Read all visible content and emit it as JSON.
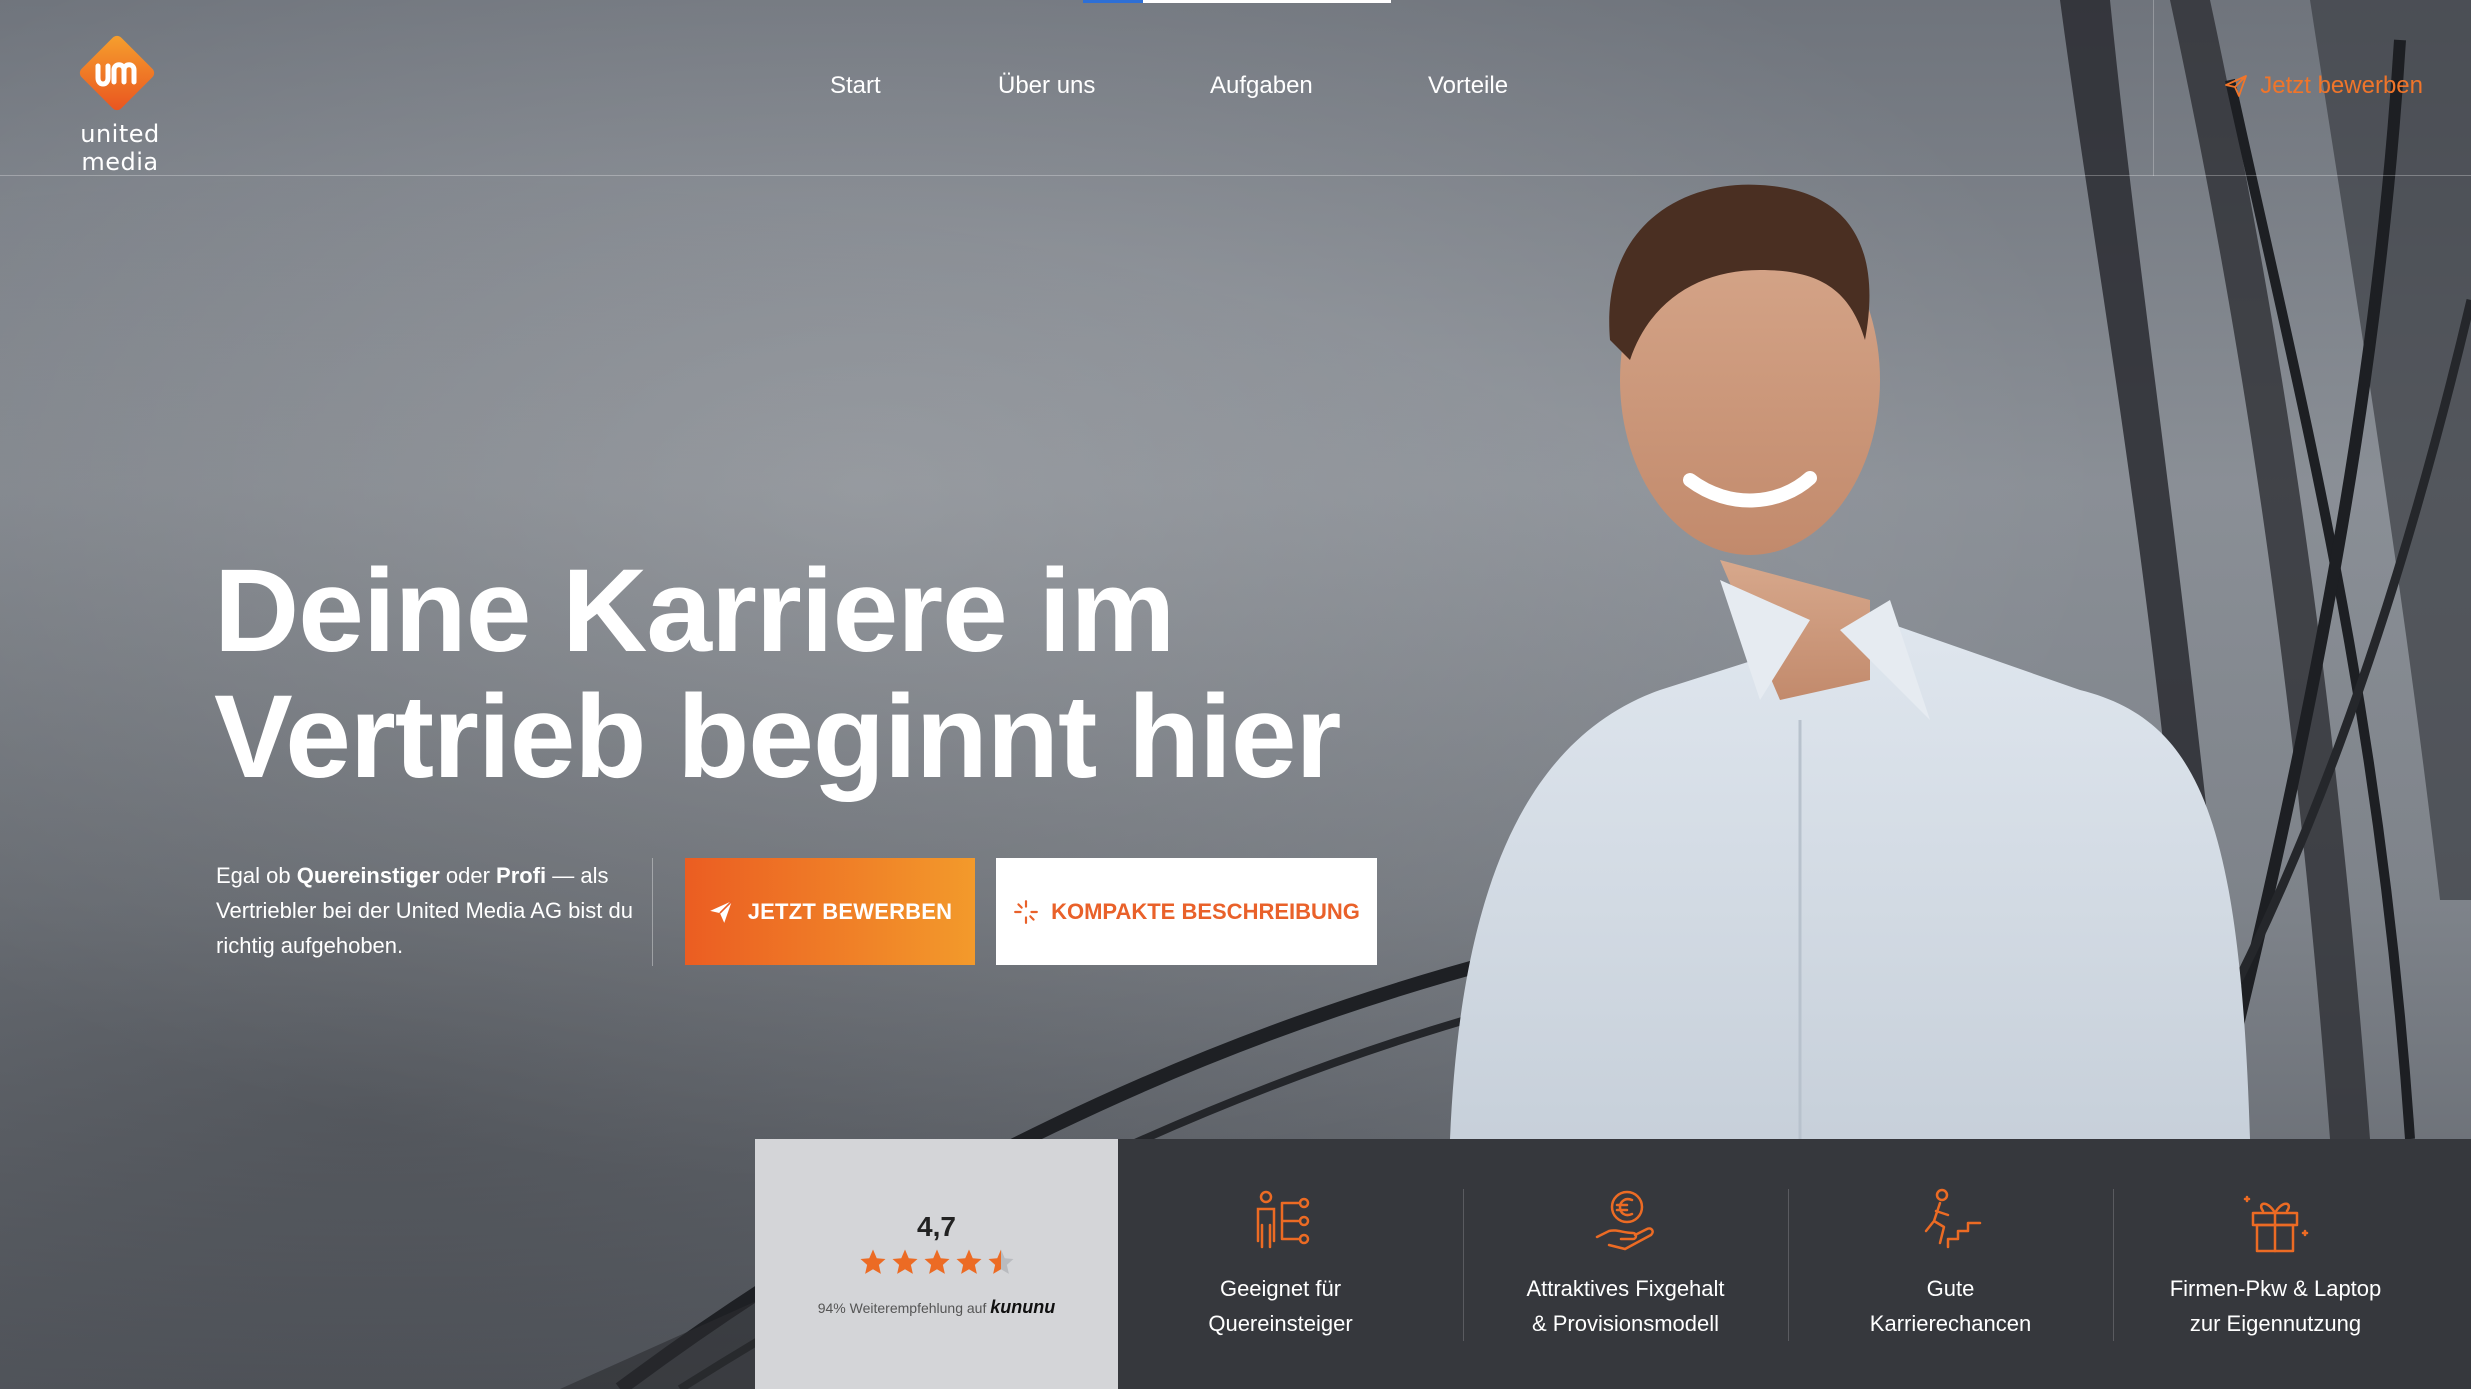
{
  "brand": {
    "name": "united media",
    "accent": "#f0752a"
  },
  "nav": {
    "items": [
      {
        "label": "Start"
      },
      {
        "label": "Über uns"
      },
      {
        "label": "Aufgaben"
      },
      {
        "label": "Vorteile"
      }
    ],
    "cta_label": "Jetzt bewerben"
  },
  "hero": {
    "headline_line1": "Deine Karriere im",
    "headline_line2": "Vertrieb beginnt hier",
    "intro": {
      "p1": "Egal ob ",
      "b1": "Quereinstiger",
      "p2": " oder ",
      "b2": "Profi",
      "p3": " — als Vertriebler bei der United Media AG bist du richtig aufgehoben."
    },
    "primary_button": "JETZT BEWERBEN",
    "secondary_button": "KOMPAKTE BESCHREIBUNG"
  },
  "rating": {
    "score": "4,7",
    "stars": 4.5,
    "note": "94% Weiterempfehlung auf",
    "platform": "kununu"
  },
  "features": [
    {
      "icon": "career-change-icon",
      "label": "Geeignet für\nQuereinsteiger"
    },
    {
      "icon": "salary-euro-icon",
      "label": "Attraktives Fixgehalt\n& Provisionsmodell"
    },
    {
      "icon": "career-stairs-icon",
      "label": "Gute\nKarrierechancen"
    },
    {
      "icon": "gift-icon",
      "label": "Firmen-Pkw & Laptop\nzur Eigennutzung"
    }
  ]
}
